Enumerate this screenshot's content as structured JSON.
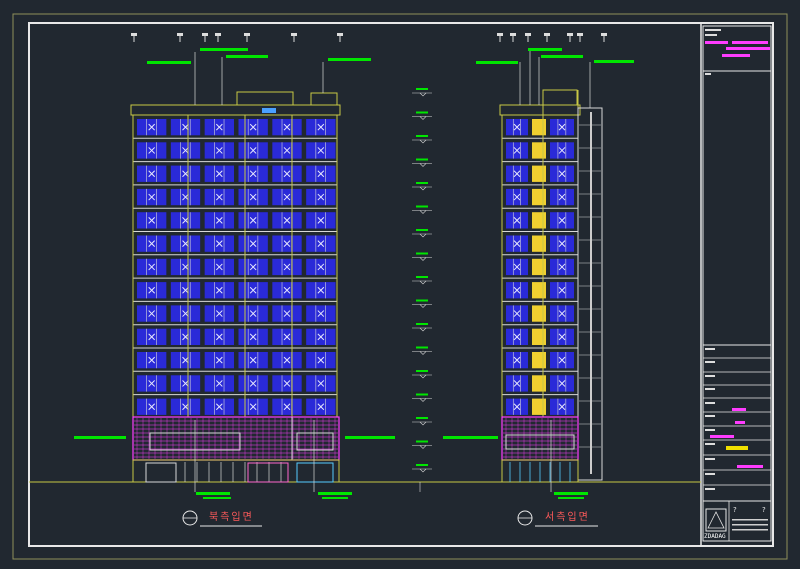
{
  "colors": {
    "background": "#212830",
    "sheet_border": "#dcdcdc",
    "facade_line": "#c8c845",
    "window": "#2a2ad8",
    "mullion": "#d8d8d8",
    "podium": "#ff3cff",
    "leader_tag": "#00e600",
    "ground_line": "#c8c845",
    "caption_text": "#ff5a5a",
    "highlight": "#f0e000"
  },
  "elevations": [
    {
      "name": "north-elevation",
      "caption": "북측입면"
    },
    {
      "name": "west-elevation",
      "caption": "서측입면"
    }
  ],
  "title_block": {
    "logo_text": "ZDADAG"
  }
}
